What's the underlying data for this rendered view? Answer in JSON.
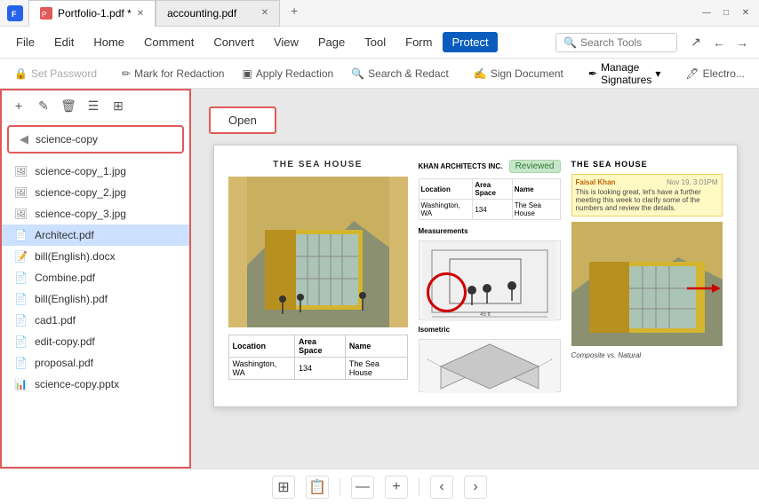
{
  "titlebar": {
    "tabs": [
      {
        "label": "Portfolio-1.pdf *",
        "active": true
      },
      {
        "label": "accounting.pdf",
        "active": false
      }
    ],
    "window_buttons": [
      "—",
      "□",
      "✕"
    ]
  },
  "menubar": {
    "items": [
      "File",
      "Edit",
      "Home",
      "Comment",
      "Convert",
      "View",
      "Page",
      "Tool",
      "Form",
      "Protect"
    ],
    "active_item": "Protect",
    "search_placeholder": "Search Tools",
    "nav_buttons": [
      "↗",
      "←",
      "→"
    ]
  },
  "toolbar": {
    "buttons": [
      {
        "label": "Set Password",
        "icon": "🔒",
        "disabled": true
      },
      {
        "label": "Mark for Redaction",
        "icon": "✏",
        "disabled": false
      },
      {
        "label": "Apply Redaction",
        "icon": "✓",
        "disabled": false
      },
      {
        "label": "Search & Redact",
        "icon": "🔍",
        "disabled": false
      },
      {
        "label": "Sign Document",
        "icon": "✍",
        "disabled": false
      }
    ],
    "manage_signatures": "Manage Signatures",
    "electro_label": "Electro..."
  },
  "left_panel": {
    "toolbar_buttons": [
      "+",
      "✎",
      "🗑",
      "☰",
      "⊞"
    ],
    "folder": {
      "icon": "◀",
      "label": "science-copy"
    },
    "files": [
      {
        "name": "science-copy_1.jpg",
        "type": "img"
      },
      {
        "name": "science-copy_2.jpg",
        "type": "img"
      },
      {
        "name": "science-copy_3.jpg",
        "type": "img"
      },
      {
        "name": "Architect.pdf",
        "type": "pdf",
        "selected": true
      },
      {
        "name": "bill(English).docx",
        "type": "doc"
      },
      {
        "name": "Combine.pdf",
        "type": "pdf"
      },
      {
        "name": "bill(English).pdf",
        "type": "pdf"
      },
      {
        "name": "cad1.pdf",
        "type": "pdf"
      },
      {
        "name": "edit-copy.pdf",
        "type": "pdf"
      },
      {
        "name": "proposal.pdf",
        "type": "pdf"
      },
      {
        "name": "science-copy.pptx",
        "type": "pptx"
      }
    ]
  },
  "content": {
    "open_button": "Open",
    "preview": {
      "left_title": "THE SEA HOUSE",
      "mid_header": "KHAN ARCHITECTS INC.",
      "reviewed": "Reviewed",
      "right_title": "THE SEA HOUSE",
      "comment_author": "Faisal Khan",
      "comment_date": "Nov 19, 3:01PM",
      "comment_text": "This is looking great, let's have a further meeting this week to clarify some of the numbers and review the details.",
      "measurements_label": "Measurements",
      "isometric_label": "Isometric",
      "composite_label": "Composite vs. Natural"
    }
  },
  "bottombar": {
    "buttons": [
      "⊞",
      "📋",
      "—",
      "+",
      "‹",
      "›"
    ]
  }
}
